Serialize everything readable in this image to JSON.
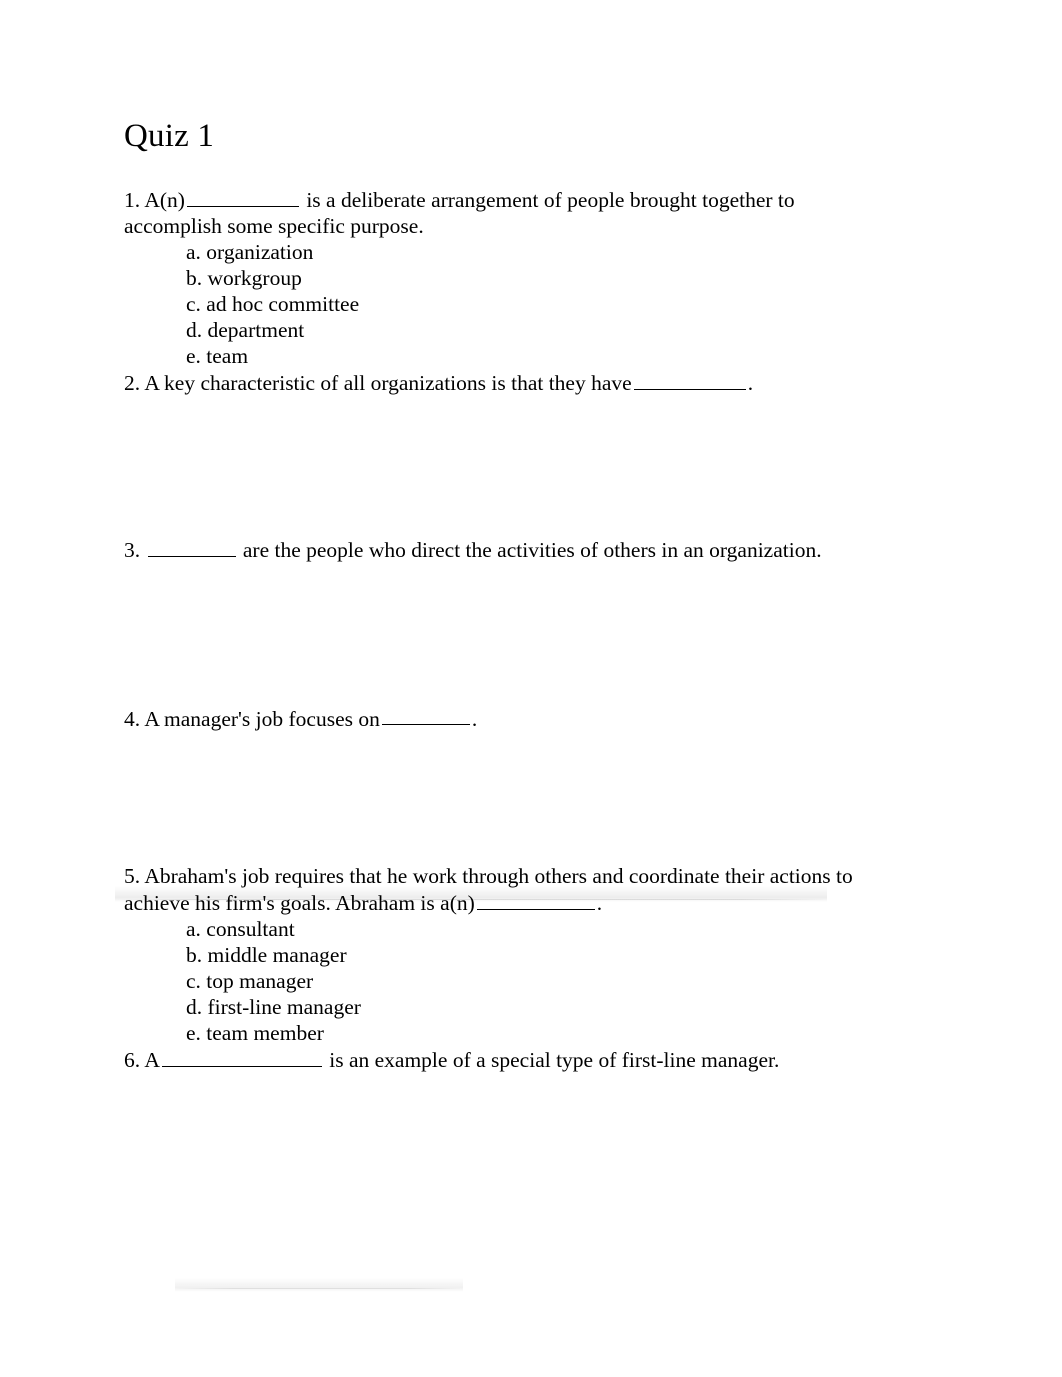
{
  "document": {
    "title": "Quiz 1",
    "questions": [
      {
        "number": "1.",
        "text_before": "A(n)",
        "blank": "___________",
        "text_after": "is a deliberate arrangement of people brought together to accomplish some specific purpose.",
        "options": [
          "a. organization",
          "b. workgroup",
          "c. ad hoc committee",
          "d. department",
          "e. team"
        ]
      },
      {
        "number": "2.",
        "text_before": "A key characteristic of all organizations is that they have",
        "blank": "___________",
        "text_after": ".",
        "options": []
      },
      {
        "number": "3.",
        "text_before": "",
        "blank": "_________",
        "text_after": "are the people who direct the activities of others in an organization.",
        "options": []
      },
      {
        "number": "4.",
        "text_before": "A manager's job focuses on",
        "blank": "_________",
        "text_after": ".",
        "options": []
      },
      {
        "number": "5.",
        "text_before": "Abraham's job requires that he work through others and coordinate their actions to achieve his firm's goals. Abraham is a(n)",
        "blank": "____________",
        "text_after": ".",
        "options": [
          "a. consultant",
          "b. middle manager",
          "c. top manager",
          "d. first-line manager",
          "e. team member"
        ]
      },
      {
        "number": "6.",
        "text_before": "A",
        "blank": "_________________",
        "text_after": "is an example of a special type of first-line manager.",
        "options": []
      }
    ]
  }
}
